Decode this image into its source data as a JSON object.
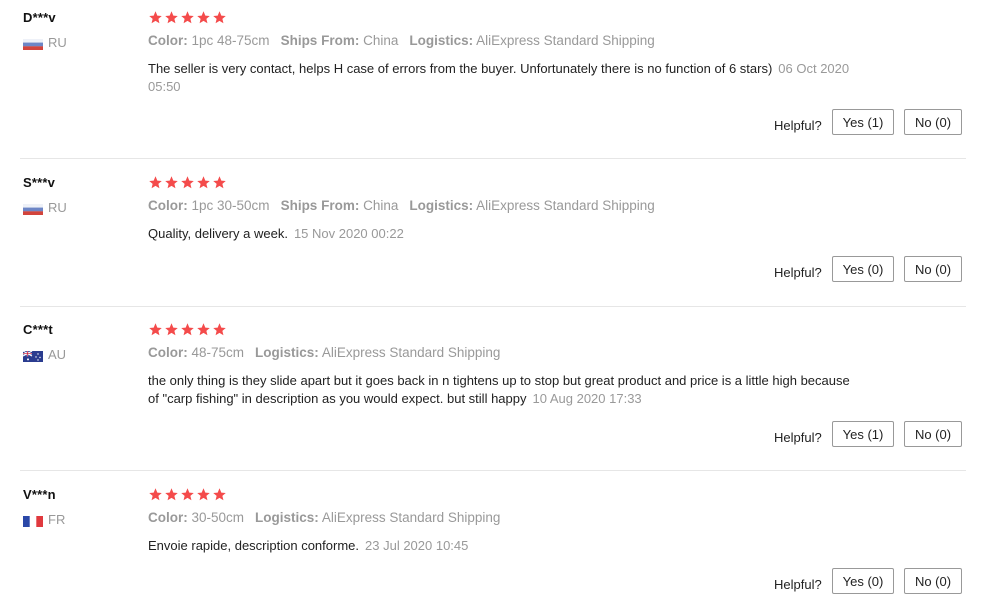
{
  "reviews": [
    {
      "user": "D***v",
      "country": "RU",
      "flag": "ru",
      "rating": 5,
      "meta": [
        {
          "k": "Color:",
          "v": "1pc 48-75cm"
        },
        {
          "k": "Ships From:",
          "v": "China"
        },
        {
          "k": "Logistics:",
          "v": "AliExpress Standard Shipping"
        }
      ],
      "text": "The seller is very contact, helps H case of errors from the buyer. Unfortunately there is no function of 6 stars)",
      "date": "06 Oct 2020 05:50",
      "helpful_label": "Helpful?",
      "yes_label": "Yes (1)",
      "no_label": "No (0)"
    },
    {
      "user": "S***v",
      "country": "RU",
      "flag": "ru",
      "rating": 5,
      "meta": [
        {
          "k": "Color:",
          "v": "1pc 30-50cm"
        },
        {
          "k": "Ships From:",
          "v": "China"
        },
        {
          "k": "Logistics:",
          "v": "AliExpress Standard Shipping"
        }
      ],
      "text": "Quality, delivery a week.",
      "date": "15 Nov 2020 00:22",
      "helpful_label": "Helpful?",
      "yes_label": "Yes (0)",
      "no_label": "No (0)"
    },
    {
      "user": "C***t",
      "country": "AU",
      "flag": "au",
      "rating": 5,
      "meta": [
        {
          "k": "Color:",
          "v": "48-75cm"
        },
        {
          "k": "Logistics:",
          "v": "AliExpress Standard Shipping"
        }
      ],
      "text": "the only thing is they slide apart but it goes back in n tightens up to stop but great product and price is a little high because of \"carp fishing\" in description as you would expect. but still happy",
      "date": "10 Aug 2020 17:33",
      "helpful_label": "Helpful?",
      "yes_label": "Yes (1)",
      "no_label": "No (0)"
    },
    {
      "user": "V***n",
      "country": "FR",
      "flag": "fr",
      "rating": 5,
      "meta": [
        {
          "k": "Color:",
          "v": "30-50cm"
        },
        {
          "k": "Logistics:",
          "v": "AliExpress Standard Shipping"
        }
      ],
      "text": "Envoie rapide, description conforme.",
      "date": "23 Jul 2020 10:45",
      "helpful_label": "Helpful?",
      "yes_label": "Yes (0)",
      "no_label": "No (0)"
    }
  ],
  "colors": {
    "star": "#f44b4b",
    "muted": "#999999",
    "divider": "#e6e6e6"
  },
  "icons": {
    "star": "star-icon",
    "flag": "country-flag-icon"
  }
}
